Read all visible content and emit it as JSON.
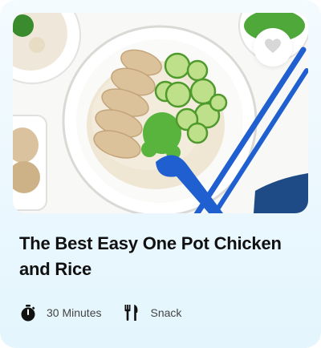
{
  "recipe": {
    "title": "The Best Easy One Pot Chicken and Rice",
    "duration": "30 Minutes",
    "category": "Snack",
    "favorite": false
  },
  "icons": {
    "favorite": "heart-icon",
    "duration": "stopwatch-icon",
    "category": "fork-knife-icon"
  },
  "colors": {
    "card_bg": "#e4f5fd",
    "title": "#111111",
    "meta_text": "#444444",
    "chopsticks": "#1f5fd0"
  }
}
